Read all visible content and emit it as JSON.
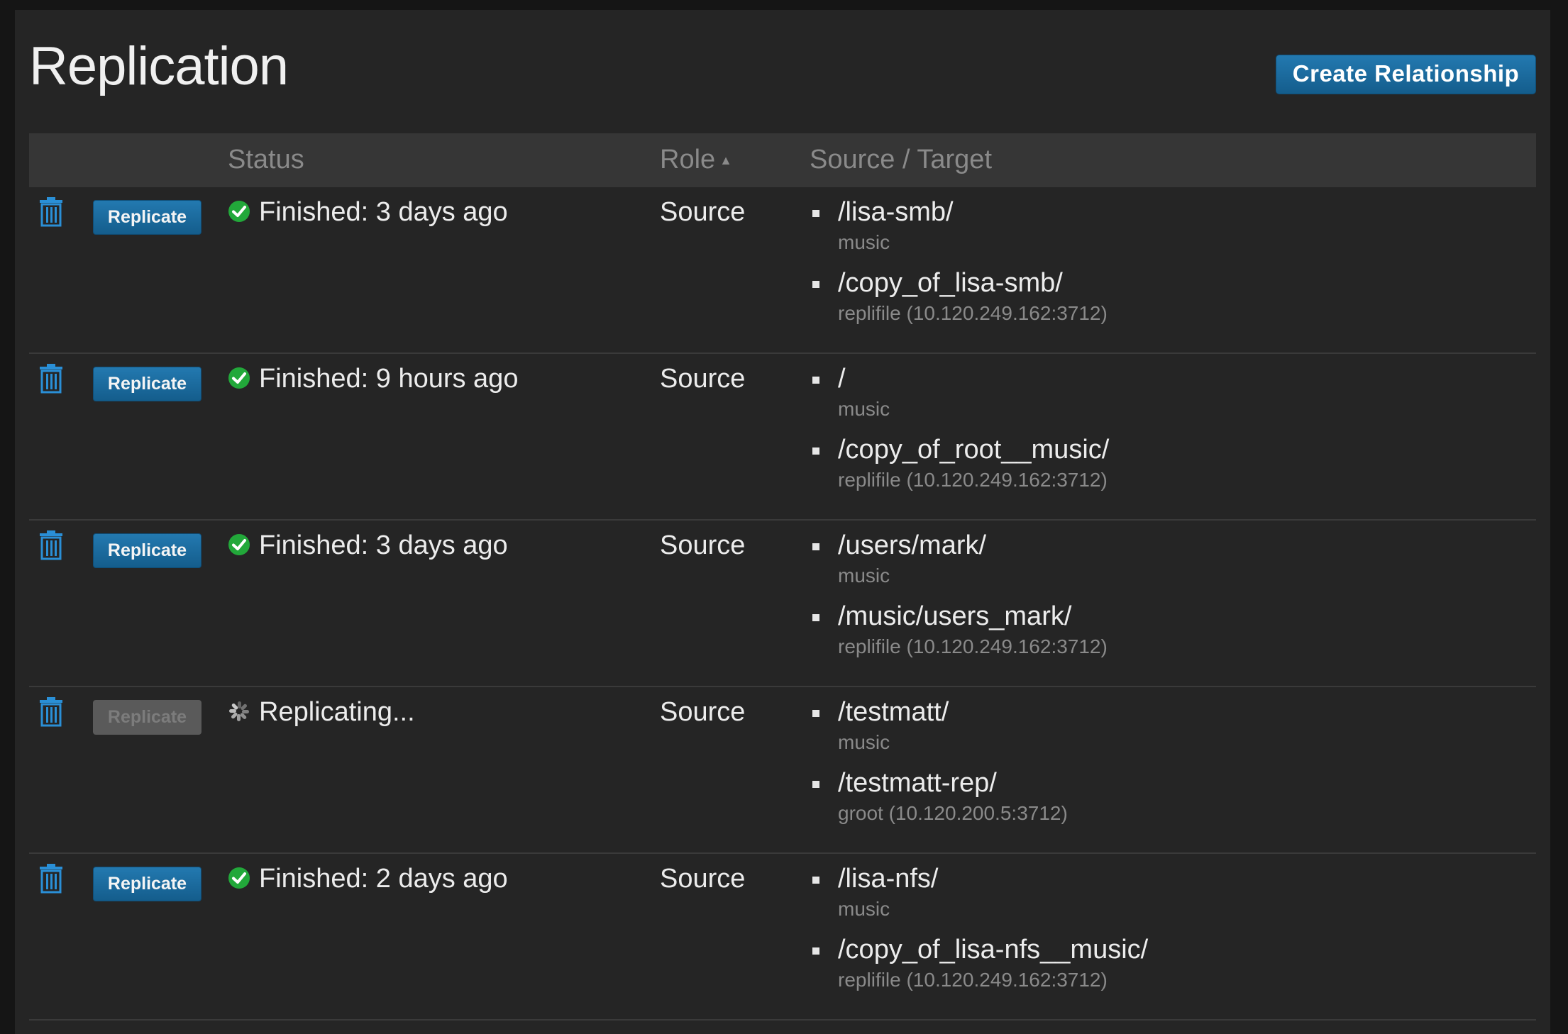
{
  "page": {
    "title": "Replication",
    "create_button": "Create Relationship"
  },
  "table": {
    "headers": {
      "status": "Status",
      "role": "Role",
      "source_target": "Source / Target"
    },
    "sort": {
      "column": "role",
      "direction": "ascending"
    },
    "rows": [
      {
        "replicate_label": "Replicate",
        "replicate_enabled": true,
        "status_icon": "check-circle-icon",
        "status": "Finished: 3 days ago",
        "role": "Source",
        "source_path": "/lisa-smb/",
        "source_host": "music",
        "target_path": "/copy_of_lisa-smb/",
        "target_host": "replifile (10.120.249.162:3712)"
      },
      {
        "replicate_label": "Replicate",
        "replicate_enabled": true,
        "status_icon": "check-circle-icon",
        "status": "Finished: 9 hours ago",
        "role": "Source",
        "source_path": "/",
        "source_host": "music",
        "target_path": "/copy_of_root__music/",
        "target_host": "replifile (10.120.249.162:3712)"
      },
      {
        "replicate_label": "Replicate",
        "replicate_enabled": true,
        "status_icon": "check-circle-icon",
        "status": "Finished: 3 days ago",
        "role": "Source",
        "source_path": "/users/mark/",
        "source_host": "music",
        "target_path": "/music/users_mark/",
        "target_host": "replifile (10.120.249.162:3712)"
      },
      {
        "replicate_label": "Replicate",
        "replicate_enabled": false,
        "status_icon": "spinner-icon",
        "status": "Replicating...",
        "role": "Source",
        "source_path": "/testmatt/",
        "source_host": "music",
        "target_path": "/testmatt-rep/",
        "target_host": "groot (10.120.200.5:3712)"
      },
      {
        "replicate_label": "Replicate",
        "replicate_enabled": true,
        "status_icon": "check-circle-icon",
        "status": "Finished: 2 days ago",
        "role": "Source",
        "source_path": "/lisa-nfs/",
        "source_host": "music",
        "target_path": "/copy_of_lisa-nfs__music/",
        "target_host": "replifile (10.120.249.162:3712)"
      }
    ]
  },
  "colors": {
    "accent": "#1b6ca3",
    "success": "#22a83a",
    "background": "#252525",
    "header_bg": "#363636"
  }
}
